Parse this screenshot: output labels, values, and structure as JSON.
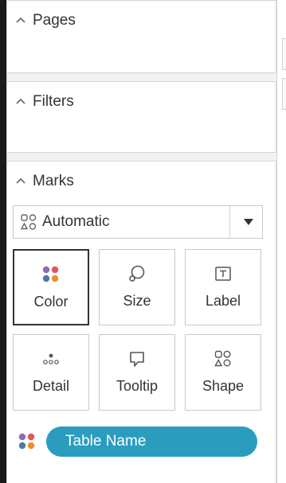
{
  "sections": {
    "pages": {
      "title": "Pages",
      "icon": "chevron-up-icon"
    },
    "filters": {
      "title": "Filters",
      "icon": "chevron-up-icon"
    },
    "marks": {
      "title": "Marks",
      "icon": "chevron-up-icon"
    }
  },
  "mark_type": {
    "selected": "Automatic",
    "icon": "automatic-marks-icon",
    "caret_icon": "dropdown-caret-icon"
  },
  "mark_cards": [
    {
      "label": "Color",
      "icon": "color-dots-icon",
      "active": true
    },
    {
      "label": "Size",
      "icon": "size-icon",
      "active": false
    },
    {
      "label": "Label",
      "icon": "label-icon",
      "active": false
    },
    {
      "label": "Detail",
      "icon": "detail-icon",
      "active": false
    },
    {
      "label": "Tooltip",
      "icon": "tooltip-icon",
      "active": false
    },
    {
      "label": "Shape",
      "icon": "shape-icon",
      "active": false
    }
  ],
  "color_field": {
    "label": "Table Name",
    "icon": "color-dots-icon",
    "pill_color": "#2a9dbf"
  },
  "colors": {
    "dot_purple": "#8e6bb3",
    "dot_red": "#e15759",
    "dot_blue": "#4e79a7",
    "dot_orange": "#f28e2b"
  }
}
